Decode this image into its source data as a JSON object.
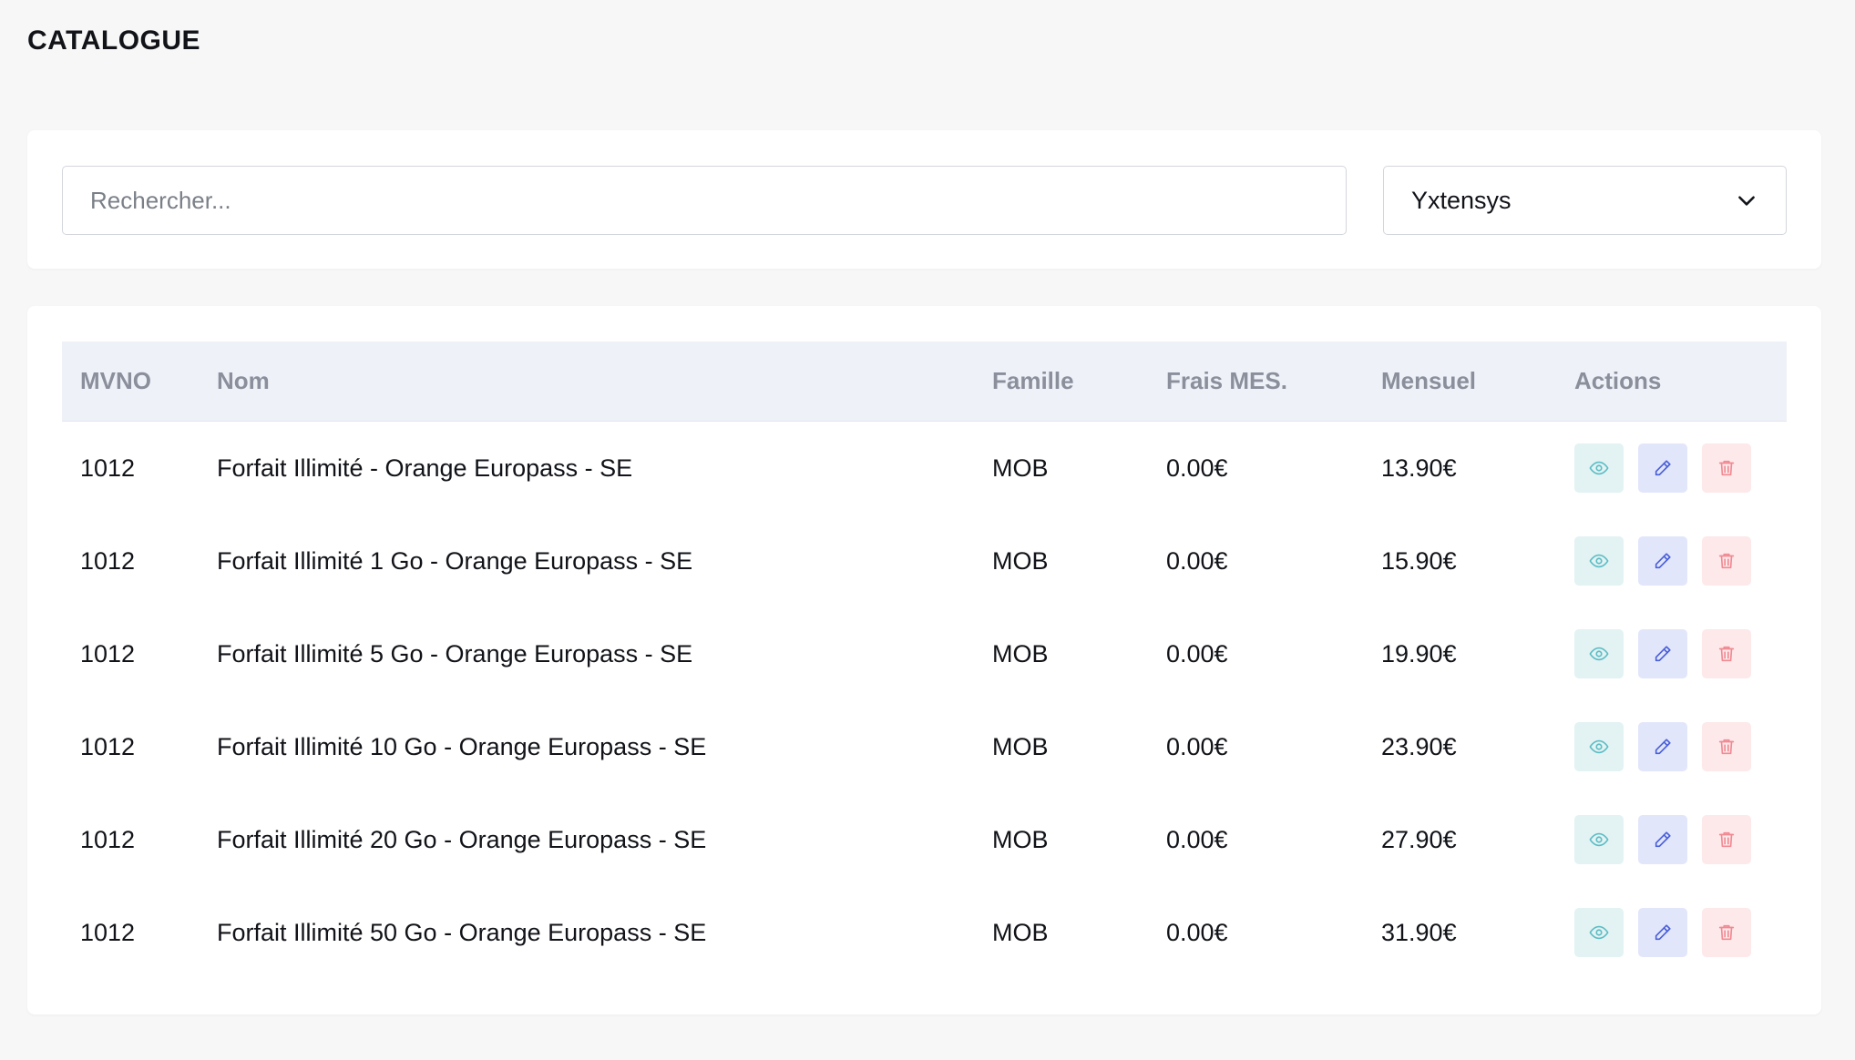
{
  "page": {
    "title": "CATALOGUE"
  },
  "filters": {
    "search_placeholder": "Rechercher...",
    "search_value": "",
    "operator_selected": "Yxtensys"
  },
  "table": {
    "headers": {
      "mvno": "MVNO",
      "nom": "Nom",
      "famille": "Famille",
      "frais": "Frais MES.",
      "mensuel": "Mensuel",
      "actions": "Actions"
    },
    "rows": [
      {
        "mvno": "1012",
        "nom": "Forfait Illimité - Orange Europass - SE",
        "famille": "MOB",
        "frais": "0.00€",
        "mensuel": "13.90€"
      },
      {
        "mvno": "1012",
        "nom": "Forfait Illimité 1 Go - Orange Europass - SE",
        "famille": "MOB",
        "frais": "0.00€",
        "mensuel": "15.90€"
      },
      {
        "mvno": "1012",
        "nom": "Forfait Illimité 5 Go - Orange Europass - SE",
        "famille": "MOB",
        "frais": "0.00€",
        "mensuel": "19.90€"
      },
      {
        "mvno": "1012",
        "nom": "Forfait Illimité 10 Go - Orange Europass - SE",
        "famille": "MOB",
        "frais": "0.00€",
        "mensuel": "23.90€"
      },
      {
        "mvno": "1012",
        "nom": "Forfait Illimité 20 Go - Orange Europass - SE",
        "famille": "MOB",
        "frais": "0.00€",
        "mensuel": "27.90€"
      },
      {
        "mvno": "1012",
        "nom": "Forfait Illimité 50 Go - Orange Europass - SE",
        "famille": "MOB",
        "frais": "0.00€",
        "mensuel": "31.90€"
      }
    ]
  },
  "icons": {
    "view": "eye-icon",
    "edit": "pencil-icon",
    "delete": "trash-icon",
    "select": "chevron-down-icon"
  },
  "colors": {
    "view_fg": "#5bbdc4",
    "edit_fg": "#4a5fd8",
    "delete_fg": "#f08a93"
  }
}
